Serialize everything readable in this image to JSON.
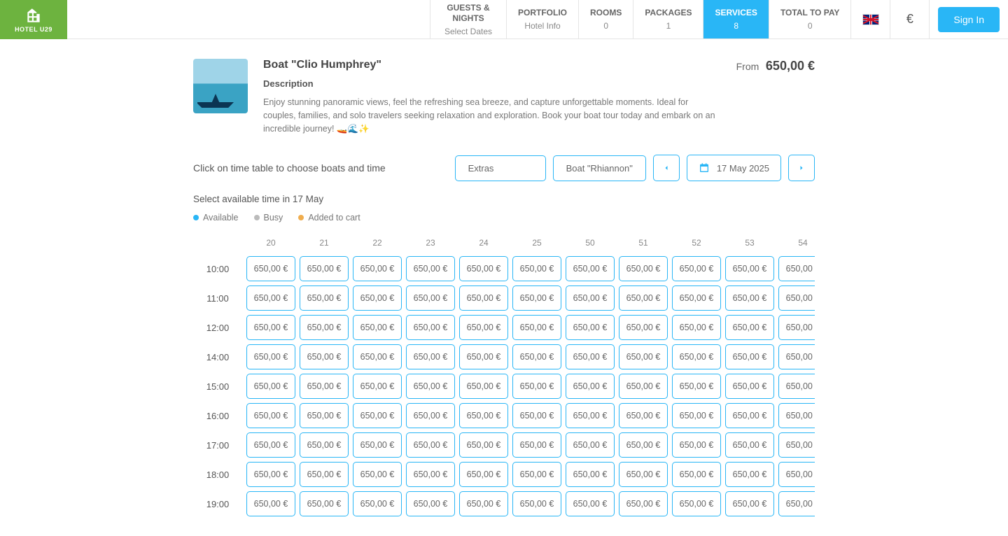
{
  "logo_text": "HOTEL U29",
  "nav": {
    "guests": {
      "title": "GUESTS & NIGHTS",
      "sub": "Select Dates"
    },
    "portfolio": {
      "title": "PORTFOLIO",
      "sub": "Hotel Info"
    },
    "rooms": {
      "title": "ROOMS",
      "sub": "0"
    },
    "packages": {
      "title": "PACKAGES",
      "sub": "1"
    },
    "services": {
      "title": "SERVICES",
      "sub": "8"
    },
    "total": {
      "title": "TOTAL TO PAY",
      "sub": "0"
    }
  },
  "currency_symbol": "€",
  "signin_label": "Sign In",
  "service": {
    "title": "Boat \"Clio Humphrey\"",
    "desc_label": "Description",
    "desc_text": "Enjoy stunning panoramic views, feel the refreshing sea breeze, and capture unforgettable moments. Ideal for couples, families, and solo travelers seeking relaxation and exploration. Book your boat tour today and embark on an incredible journey! 🚤🌊✨",
    "price_from_label": "From",
    "price_amount": "650,00 €"
  },
  "instruction": "Click on time table to choose boats and time",
  "dropdowns": {
    "extras": "Extras",
    "boat": "Boat \"Rhiannon\""
  },
  "date_label": "17 May 2025",
  "subhead": "Select available time in 17 May",
  "legend": {
    "available": "Available",
    "busy": "Busy",
    "added": "Added to cart"
  },
  "columns": [
    "20",
    "21",
    "22",
    "23",
    "24",
    "25",
    "50",
    "51",
    "52",
    "53",
    "54"
  ],
  "rows": [
    "10:00",
    "11:00",
    "12:00",
    "14:00",
    "15:00",
    "16:00",
    "17:00",
    "18:00",
    "19:00"
  ],
  "cell_price": "650,00 €"
}
